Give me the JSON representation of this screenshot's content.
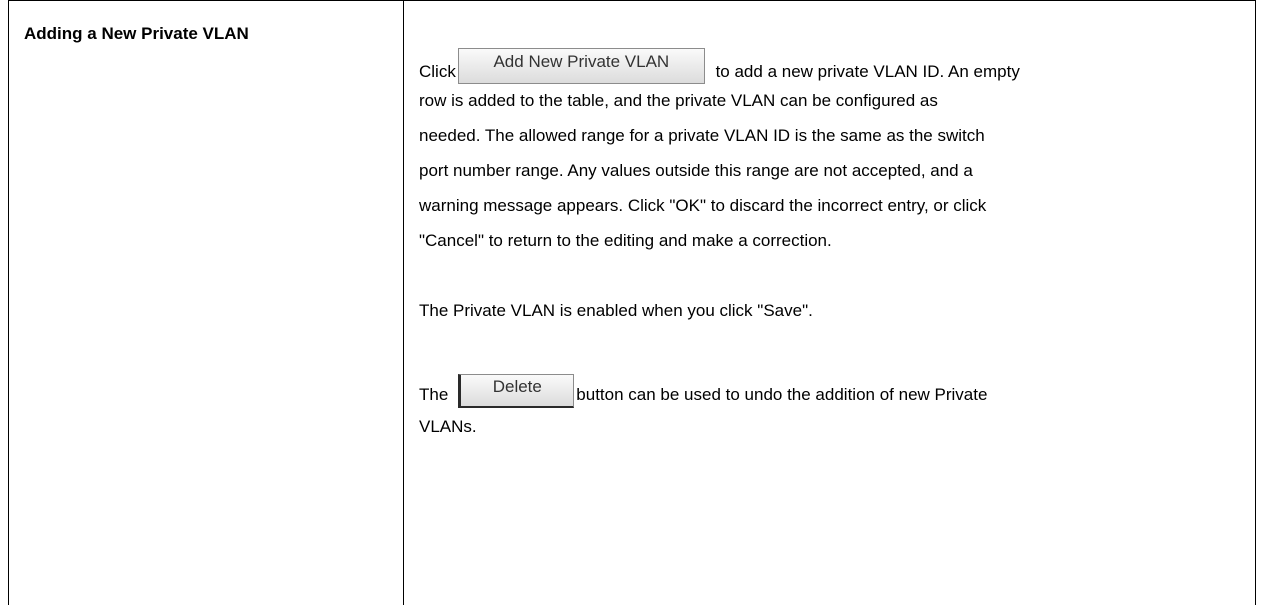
{
  "section_heading": "Adding a New Private VLAN",
  "paragraph1": {
    "lead": "Click",
    "add_button_label": "Add New Private VLAN",
    "after_button": "to add a new private VLAN ID. An empty",
    "lines": [
      "row is added to the table, and the private VLAN can be configured as",
      "needed. The allowed range for a private VLAN ID is the same as the switch",
      "port number range. Any values outside this range are not accepted, and a",
      "warning message appears. Click \"OK\" to discard the incorrect entry, or click",
      "\"Cancel\" to return to the editing and make a correction."
    ]
  },
  "paragraph2": "The Private VLAN is enabled when you click \"Save\".",
  "paragraph3": {
    "lead": "The",
    "delete_button_label": "Delete",
    "after_button": "button can be used to undo the addition of new Private",
    "last_line": "VLANs."
  }
}
